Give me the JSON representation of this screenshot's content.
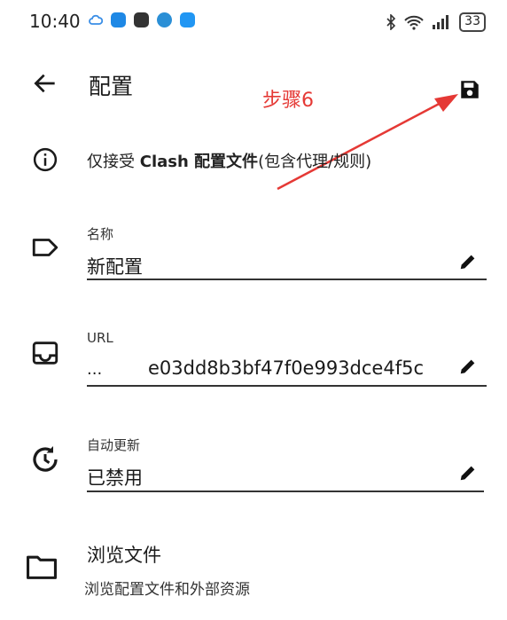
{
  "status_bar": {
    "time": "10:40",
    "battery": "33"
  },
  "header": {
    "title": "配置",
    "back_icon": "arrow-left-icon",
    "save_icon": "save-icon"
  },
  "annotation": {
    "text": "步骤6",
    "color": "#e53935"
  },
  "info": {
    "prefix": "仅接受 ",
    "bold": "Clash 配置文件",
    "suffix": "(包含代理/规则)"
  },
  "fields": {
    "name": {
      "label": "名称",
      "value": "新配置"
    },
    "url": {
      "label": "URL",
      "prefix": "...",
      "value": "e03dd8b3bf47f0e993dce4f5c"
    },
    "auto_update": {
      "label": "自动更新",
      "value": "已禁用"
    }
  },
  "browse": {
    "title": "浏览文件",
    "subtitle": "浏览配置文件和外部资源"
  },
  "colors": {
    "accent_red": "#e53935",
    "text": "#1a1a1a"
  }
}
